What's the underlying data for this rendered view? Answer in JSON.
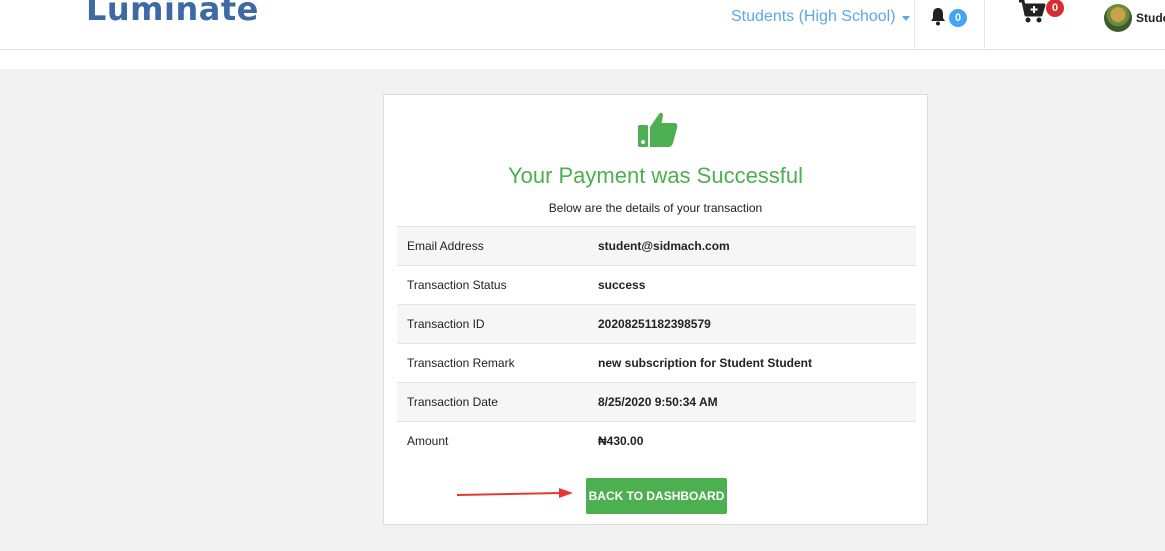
{
  "header": {
    "logo_text": "uminate",
    "logo_mark": "L",
    "school_selector": "Students (High School)",
    "notifications_count": "0",
    "cart_count": "0",
    "user_name": "Stude"
  },
  "card": {
    "icon": "thumbs-up-icon",
    "title": "Your Payment was Successful",
    "subtitle": "Below are the details of your transaction",
    "rows": [
      {
        "label": "Email Address",
        "value": "student@sidmach.com"
      },
      {
        "label": "Transaction Status",
        "value": "success"
      },
      {
        "label": "Transaction ID",
        "value": "20208251182398579"
      },
      {
        "label": "Transaction Remark",
        "value": "new subscription for Student Student"
      },
      {
        "label": "Transaction Date",
        "value": "8/25/2020 9:50:34 AM"
      },
      {
        "label": "Amount",
        "value": "₦430.00"
      }
    ],
    "button_label": "BACK TO DASHBOARD"
  },
  "colors": {
    "brand": "#3d6aa5",
    "success": "#4caf50",
    "link": "#5aa9e6",
    "annotation_arrow": "#e53935"
  }
}
